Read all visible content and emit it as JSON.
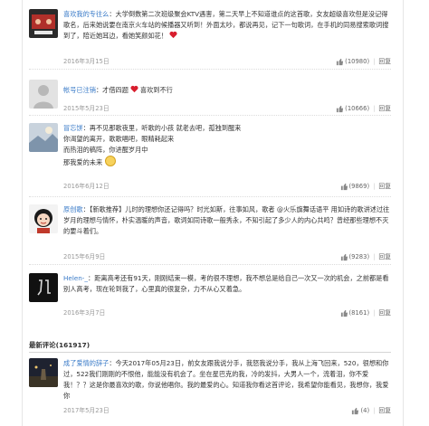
{
  "comments": [
    {
      "user": "喜欢我的专往么",
      "text": "：大学倒数第二次班级聚会KTV遇害，第二天早上不知道谁点的这首歌，女友超级喜欢但是没记得歌名，后来她说要在南京火车站的候播器又听到！外面太吵，都说再见，记下一句歌词，在手机的同易搜索歌词搜到了，陪近她耳边，看她笑颜如花！",
      "date": "2016年3月15日",
      "likes": "(10980)",
      "reply": "回复"
    },
    {
      "user": "帐号已注销",
      "text": "：才借四题",
      "tail": "喜欢到不行",
      "date": "2015年5月23日",
      "likes": "(10666)",
      "reply": "回复"
    },
    {
      "user": "冒忘饼",
      "lines": [
        "：再不见那歌夜里，听歌的小孩 就老去吧，孤独到醒来",
        "你渴望的离开，歌歌唱吧，眼精耗起来",
        "而热泪的稿阵，你进醒岁月中",
        "那我爱的未来"
      ],
      "date": "2016年6月12日",
      "likes": "(9869)",
      "reply": "回复"
    },
    {
      "user": "原创歌",
      "text": "：【新歌推荐】儿时的理想你还记得吗？时光如斯，往事如风，歌者 @火乐旗舞话语平 用如诗的歌讲述过往岁月的理想与情怀，朴实温暖的声音，歌词如同诗歌一般秀永，不知引起了多少人的内心共鸣？曾经那些理想不灭的要斗着们。",
      "date": "2015年6月9日",
      "likes": "(9283)",
      "reply": "回复"
    },
    {
      "user": "Helen-_",
      "text": "：距离高考还有91天，刚刚结束一模，考的很不理想，我不想总是给自己一次又一次的机会，之前都是看别人高考，现在轮到我了，心里真的很复杂，力不从心又着急。",
      "date": "2016年3月7日",
      "likes": "(8161)",
      "reply": "回复"
    }
  ],
  "section_title": "最新评论(161917)",
  "latest": {
    "user": "成了爱情的辞子",
    "text": "：今天2017年05月23日，前女友跟我说分手，我怒我说分手，我从上海飞回来，520，很想和你过，522我们刚刚的不恨他，能能没有机会了。坐在星巴克的我，冷的发抖，大男人一个，流着泪，你不爱我！？？这是你最喜欢的歌，你说他唱你。我的最爱的心。知道我你看这首评论，我希望你能看见，我想你，我爱你",
    "date": "2017年5月23日",
    "likes": "(4)",
    "reply": "回复"
  },
  "colors": {
    "username": "#3a7bc8",
    "text": "#333333",
    "meta": "#999999",
    "heart": "#d81e2e"
  }
}
